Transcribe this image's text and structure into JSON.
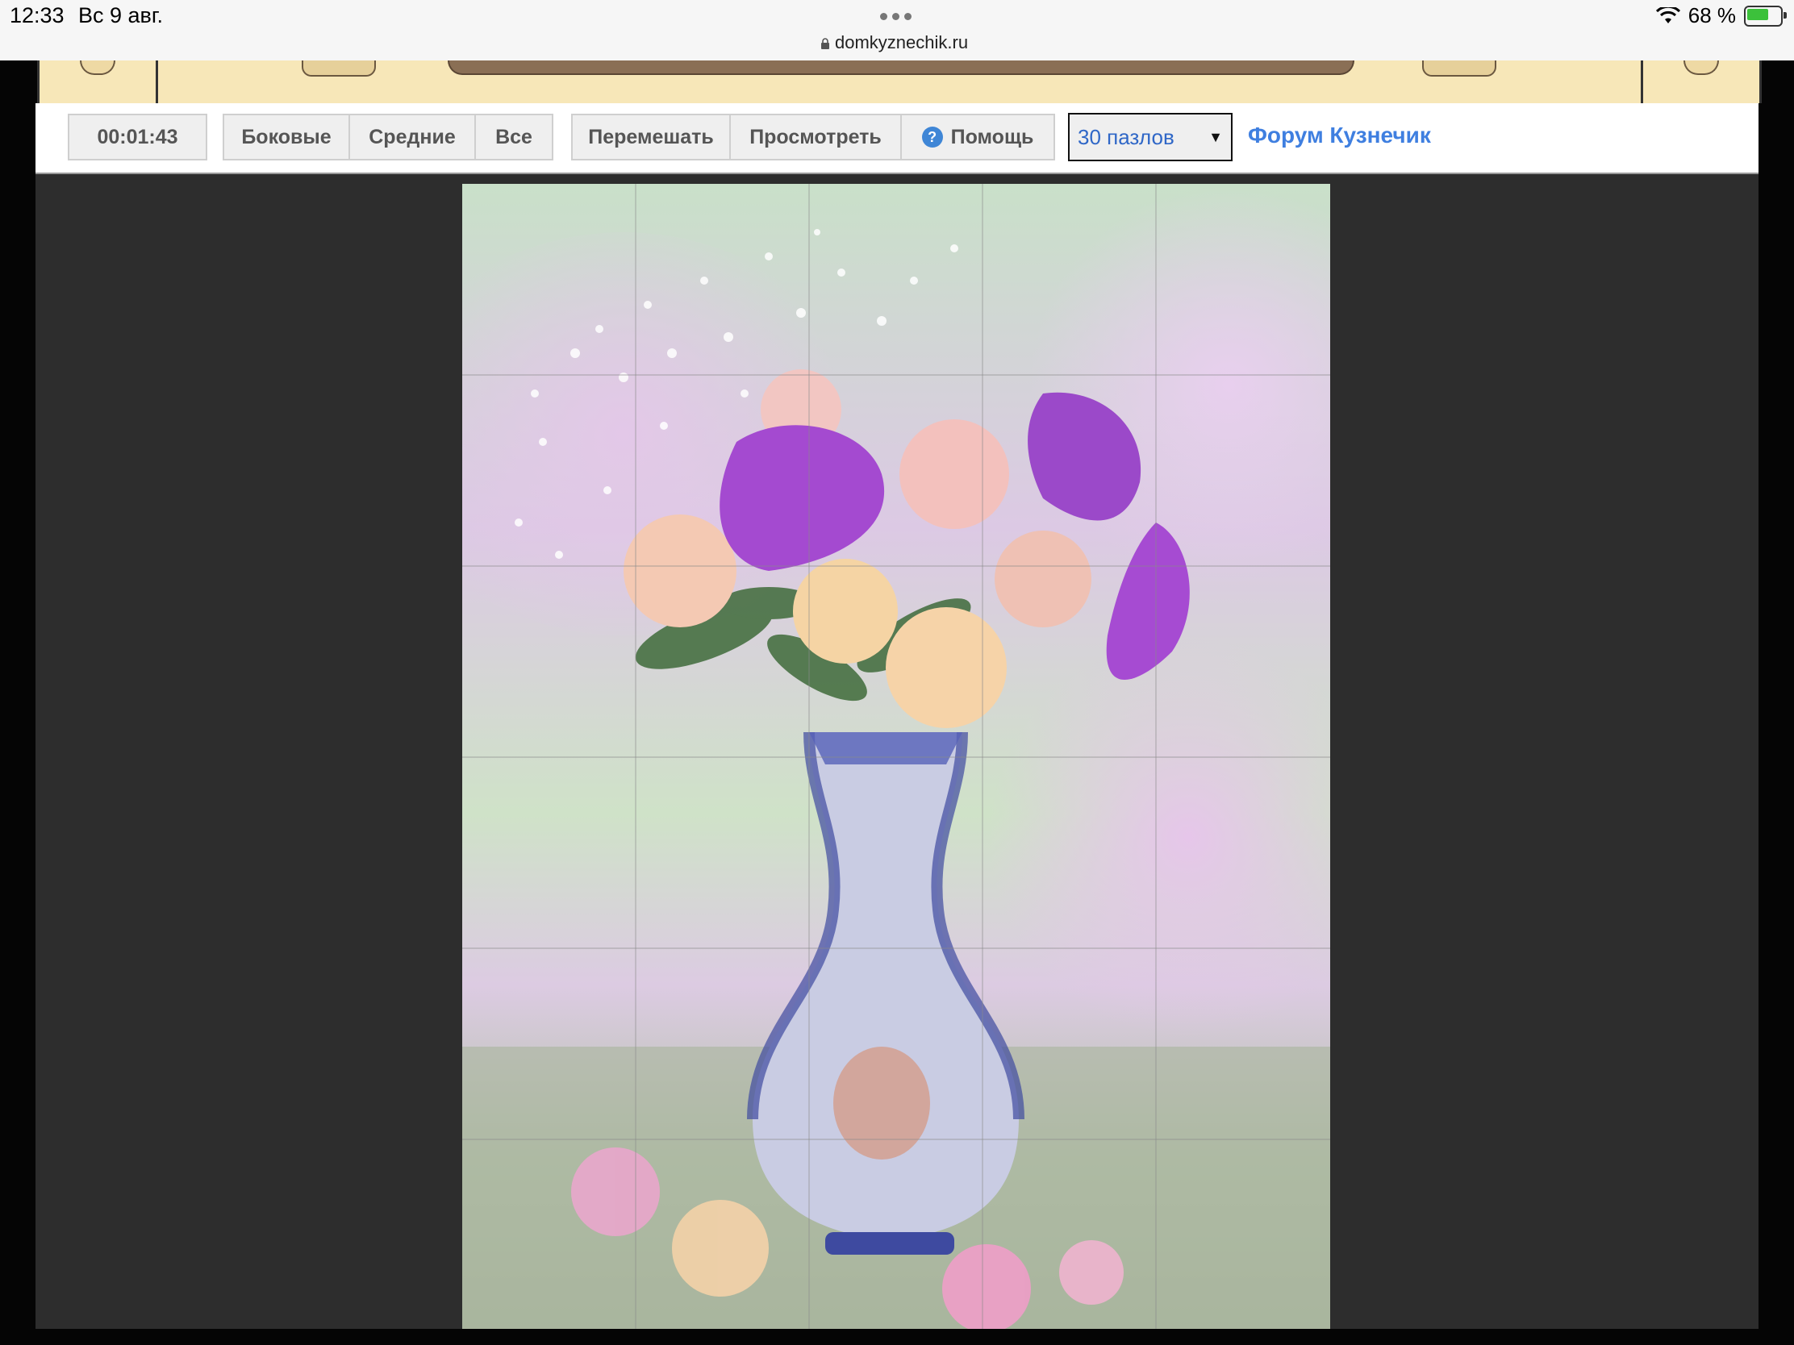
{
  "status": {
    "time": "12:33",
    "date": "Вс 9 авг.",
    "battery": "68 %",
    "url": "domkyznechik.ru"
  },
  "toolbar": {
    "timer": "00:01:43",
    "filters": [
      "Боковые",
      "Средние",
      "Все"
    ],
    "actions": [
      "Перемешать",
      "Просмотреть",
      "Помощь"
    ],
    "select_value": "30 пазлов",
    "forum_link": "Форум Кузнечик"
  },
  "puzzle": {
    "rows": 6,
    "cols": 5
  }
}
